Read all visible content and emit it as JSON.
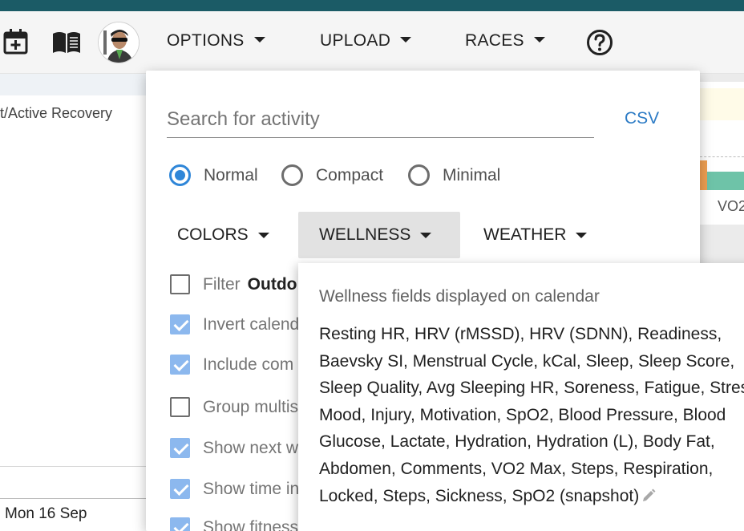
{
  "toolbar": {
    "menus": [
      {
        "label": "OPTIONS"
      },
      {
        "label": "UPLOAD"
      },
      {
        "label": "RACES"
      }
    ],
    "icons": [
      "add-calendar-icon",
      "book-icon",
      "avatar",
      "help-icon"
    ]
  },
  "left_panel": {
    "activity_text": "t/Active Recovery",
    "date_label": "Mon 16 Sep"
  },
  "right_panel": {
    "label": "VO2"
  },
  "options_panel": {
    "search": {
      "placeholder": "Search for activity",
      "value": ""
    },
    "csv_label": "CSV",
    "view_modes": [
      {
        "label": "Normal",
        "selected": true
      },
      {
        "label": "Compact",
        "selected": false
      },
      {
        "label": "Minimal",
        "selected": false
      }
    ],
    "submenus": [
      {
        "label": "COLORS",
        "active": false
      },
      {
        "label": "WELLNESS",
        "active": true
      },
      {
        "label": "WEATHER",
        "active": false
      }
    ],
    "checkboxes": [
      {
        "label": "Filter",
        "value": "Outdo",
        "checked": false
      },
      {
        "label": "Invert calend",
        "checked": true
      },
      {
        "label": "Include com",
        "checked": true
      },
      {
        "label": "Group multis",
        "checked": false
      },
      {
        "label": "Show next w",
        "checked": true
      },
      {
        "label": "Show time in",
        "checked": true
      },
      {
        "label": "Show fitness",
        "checked": true
      }
    ]
  },
  "wellness_popup": {
    "heading": "Wellness fields displayed on calendar",
    "fields_text": "Resting HR, HRV (rMSSD), HRV (SDNN), Readiness, Baevsky SI, Menstrual Cycle, kCal, Sleep, Sleep Score, Sleep Quality, Avg Sleeping HR, Soreness, Fatigue, Stress, Mood, Injury, Motivation, SpO2, Blood Pressure, Blood Glucose, Lactate, Hydration, Hydration (L), Body Fat, Abdomen, Comments, VO2 Max, Steps, Respiration, Locked, Steps, Sickness, SpO2 (snapshot)"
  },
  "colors": {
    "accent": "#2f86d8",
    "checkbox_checked": "#8cb8ee",
    "link": "#2c7bc5",
    "topbar": "#1b5b66"
  }
}
